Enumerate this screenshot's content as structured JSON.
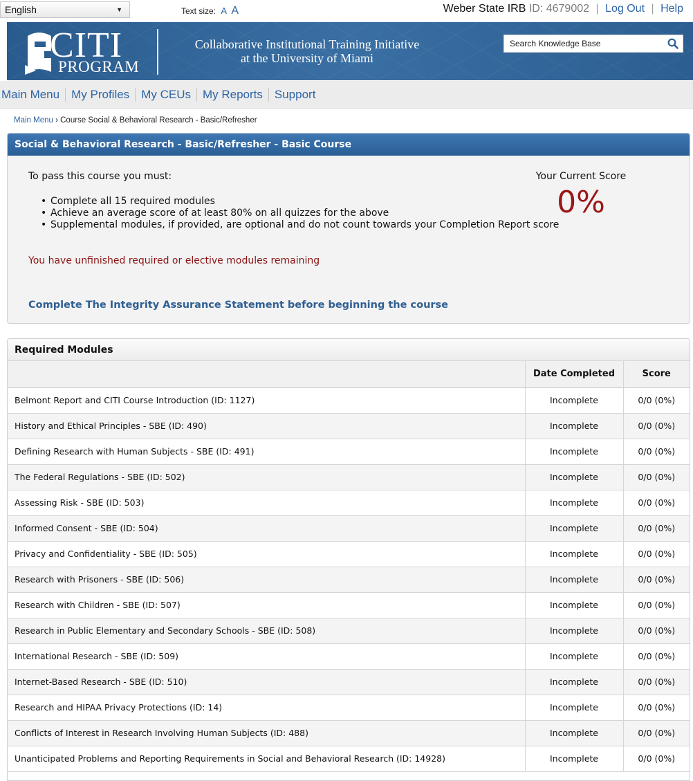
{
  "topbar": {
    "language": "English",
    "text_size_label": "Text size:",
    "text_size_small": "A",
    "text_size_large": "A",
    "institution": "Weber State IRB",
    "id_text": "ID: 4679002",
    "logout": "Log Out",
    "help": "Help"
  },
  "banner": {
    "logo_main": "CITI",
    "logo_sub": "PROGRAM",
    "title_line1": "Collaborative Institutional Training Initiative",
    "title_line2": "at the University of Miami",
    "search_placeholder": "Search Knowledge Base"
  },
  "nav": {
    "items": [
      "Main Menu",
      "My Profiles",
      "My CEUs",
      "My Reports",
      "Support"
    ]
  },
  "breadcrumb": {
    "home": "Main Menu",
    "current": "› Course Social & Behavioral Research - Basic/Refresher"
  },
  "course": {
    "title": "Social & Behavioral Research - Basic/Refresher - Basic Course",
    "pass_intro": "To pass this course you must:",
    "requirements": [
      "Complete all 15 required modules",
      "Achieve an average score of at least 80% on all quizzes for the above",
      "Supplemental modules, if provided, are optional and do not count towards your Completion Report score"
    ],
    "unfinished_notice": "You have unfinished required or elective modules remaining",
    "integrity_link": "Complete The Integrity Assurance Statement before beginning the course",
    "score_label": "Your Current Score",
    "score_value": "0%"
  },
  "modules": {
    "heading": "Required Modules",
    "col_date": "Date Completed",
    "col_score": "Score",
    "rows": [
      {
        "name": "Belmont Report and CITI Course Introduction (ID: 1127)",
        "date": "Incomplete",
        "score": "0/0 (0%)"
      },
      {
        "name": "History and Ethical Principles - SBE (ID: 490)",
        "date": "Incomplete",
        "score": "0/0 (0%)"
      },
      {
        "name": "Defining Research with Human Subjects - SBE (ID: 491)",
        "date": "Incomplete",
        "score": "0/0 (0%)"
      },
      {
        "name": "The Federal Regulations - SBE (ID: 502)",
        "date": "Incomplete",
        "score": "0/0 (0%)"
      },
      {
        "name": "Assessing Risk - SBE (ID: 503)",
        "date": "Incomplete",
        "score": "0/0 (0%)"
      },
      {
        "name": "Informed Consent - SBE (ID: 504)",
        "date": "Incomplete",
        "score": "0/0 (0%)"
      },
      {
        "name": "Privacy and Confidentiality - SBE (ID: 505)",
        "date": "Incomplete",
        "score": "0/0 (0%)"
      },
      {
        "name": "Research with Prisoners - SBE (ID: 506)",
        "date": "Incomplete",
        "score": "0/0 (0%)"
      },
      {
        "name": "Research with Children - SBE (ID: 507)",
        "date": "Incomplete",
        "score": "0/0 (0%)"
      },
      {
        "name": "Research in Public Elementary and Secondary Schools - SBE (ID: 508)",
        "date": "Incomplete",
        "score": "0/0 (0%)"
      },
      {
        "name": "International Research - SBE (ID: 509)",
        "date": "Incomplete",
        "score": "0/0 (0%)"
      },
      {
        "name": "Internet-Based Research - SBE (ID: 510)",
        "date": "Incomplete",
        "score": "0/0 (0%)"
      },
      {
        "name": "Research and HIPAA Privacy Protections (ID: 14)",
        "date": "Incomplete",
        "score": "0/0 (0%)"
      },
      {
        "name": "Conflicts of Interest in Research Involving Human Subjects (ID: 488)",
        "date": "Incomplete",
        "score": "0/0 (0%)"
      },
      {
        "name": "Unanticipated Problems and Reporting Requirements in Social and Behavioral Research (ID: 14928)",
        "date": "Incomplete",
        "score": "0/0 (0%)"
      }
    ]
  },
  "colors": {
    "brand_blue": "#2b5f93",
    "link_blue": "#2d64a5",
    "score_red": "#9b1717",
    "notice_red": "#8b1212"
  },
  "icons": {
    "search": "search-icon",
    "dropdown": "chevron-down-icon",
    "logo": "citi-logo-icon"
  }
}
